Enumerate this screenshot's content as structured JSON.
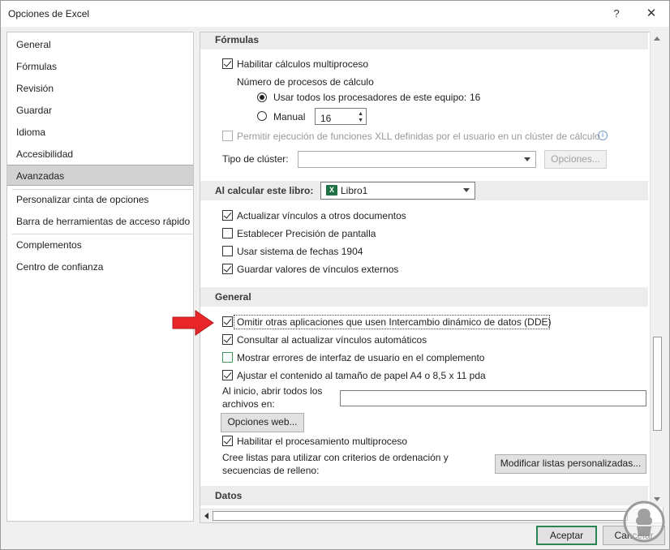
{
  "window": {
    "title": "Opciones de Excel",
    "help_glyph": "?",
    "close_glyph": "✕"
  },
  "sidebar": {
    "items": [
      {
        "label": "General"
      },
      {
        "label": "Fórmulas"
      },
      {
        "label": "Revisión"
      },
      {
        "label": "Guardar"
      },
      {
        "label": "Idioma"
      },
      {
        "label": "Accesibilidad"
      },
      {
        "label": "Avanzadas",
        "selected": true
      },
      {
        "label": "Personalizar cinta de opciones"
      },
      {
        "label": "Barra de herramientas de acceso rápido"
      },
      {
        "label": "Complementos"
      },
      {
        "label": "Centro de confianza"
      }
    ]
  },
  "formulas": {
    "header": "Fórmulas",
    "multithread": {
      "label": "Habilitar cálculos multiproceso",
      "checked": true
    },
    "threads_label": "Número de procesos de cálculo",
    "use_all": {
      "label": "Usar todos los procesadores de este equipo:",
      "value": "16",
      "selected": true
    },
    "manual": {
      "label": "Manual",
      "value": "16",
      "selected": false
    },
    "xll_cluster": {
      "label": "Permitir ejecución de funciones XLL definidas por el usuario en un clúster de cálculo",
      "checked": false,
      "disabled": true,
      "info_glyph": "i"
    },
    "cluster_type_label": "Tipo de clúster:",
    "cluster_type_value": "",
    "options_button": "Opciones..."
  },
  "workbook_calc": {
    "header": "Al calcular este libro:",
    "workbook_icon": "excel-icon",
    "workbook_icon_letter": "X",
    "workbook_value": "Libro1",
    "options": [
      {
        "label": "Actualizar vínculos a otros documentos",
        "checked": true
      },
      {
        "label": "Establecer Precisión de pantalla",
        "checked": false
      },
      {
        "label": "Usar sistema de fechas 1904",
        "checked": false
      },
      {
        "label": "Guardar valores de vínculos externos",
        "checked": true
      }
    ]
  },
  "general": {
    "header": "General",
    "options": [
      {
        "label": "Omitir otras aplicaciones que usen Intercambio dinámico de datos (DDE)",
        "checked": true
      },
      {
        "label": "Consultar al actualizar vínculos automáticos",
        "checked": true
      },
      {
        "label": "Mostrar errores de interfaz de usuario en el complemento",
        "checked": false
      },
      {
        "label": "Ajustar el contenido al tamaño de papel A4 o 8,5 x 11 pda",
        "checked": true
      }
    ],
    "startup_label_line1": "Al inicio, abrir todos los",
    "startup_label_line2": "archivos en:",
    "startup_value": "",
    "web_options_button": "Opciones web...",
    "multithread_processing": {
      "label": "Habilitar el procesamiento multiproceso",
      "checked": true
    },
    "lists_label_line1": "Cree listas para utilizar con criterios de ordenación y",
    "lists_label_line2": "secuencias de relleno:",
    "edit_lists_button": "Modificar listas personalizadas..."
  },
  "data": {
    "header": "Datos"
  },
  "footer": {
    "ok": "Aceptar",
    "cancel": "Cancelar"
  },
  "colors": {
    "arrow": "#e8262a",
    "accent_green": "#2a8553",
    "excel_green": "#1e7145"
  }
}
